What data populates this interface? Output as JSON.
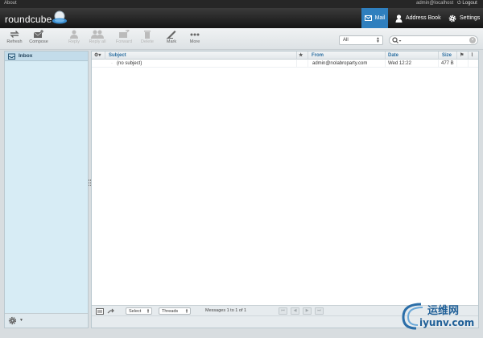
{
  "topbar": {
    "about": "About",
    "user": "admin@localhost",
    "logout": "Logout"
  },
  "header": {
    "logo_text": "roundcube",
    "nav": {
      "mail": "Mail",
      "address_book": "Address Book",
      "settings": "Settings"
    }
  },
  "toolbar": {
    "refresh": "Refresh",
    "compose": "Compose",
    "reply": "Reply",
    "reply_all": "Reply all",
    "forward": "Forward",
    "delete": "Delete",
    "mark": "Mark",
    "more": "More"
  },
  "filter": {
    "selected": "All"
  },
  "search": {
    "value": ""
  },
  "folders": [
    {
      "label": "Inbox"
    }
  ],
  "message_list": {
    "columns": {
      "subject": "Subject",
      "flag": "★",
      "from": "From",
      "date": "Date",
      "size": "Size"
    },
    "rows": [
      {
        "subject": "(no subject)",
        "from": "admin@nolabroparty.com",
        "date": "Wed 12:22",
        "size": "477 B"
      }
    ]
  },
  "list_footer": {
    "select": "Select",
    "threads": "Threads",
    "count": "Messages 1 to 1 of 1",
    "pager": [
      "⏮",
      "◀",
      "▶",
      "⏭"
    ]
  },
  "colors": {
    "accent": "#2f7fbe",
    "sidebar_bg": "#d7ecf5",
    "header_bg": "#1e1e1e"
  },
  "watermark": {
    "text1": "运维网",
    "text2": "iyunv.com"
  }
}
